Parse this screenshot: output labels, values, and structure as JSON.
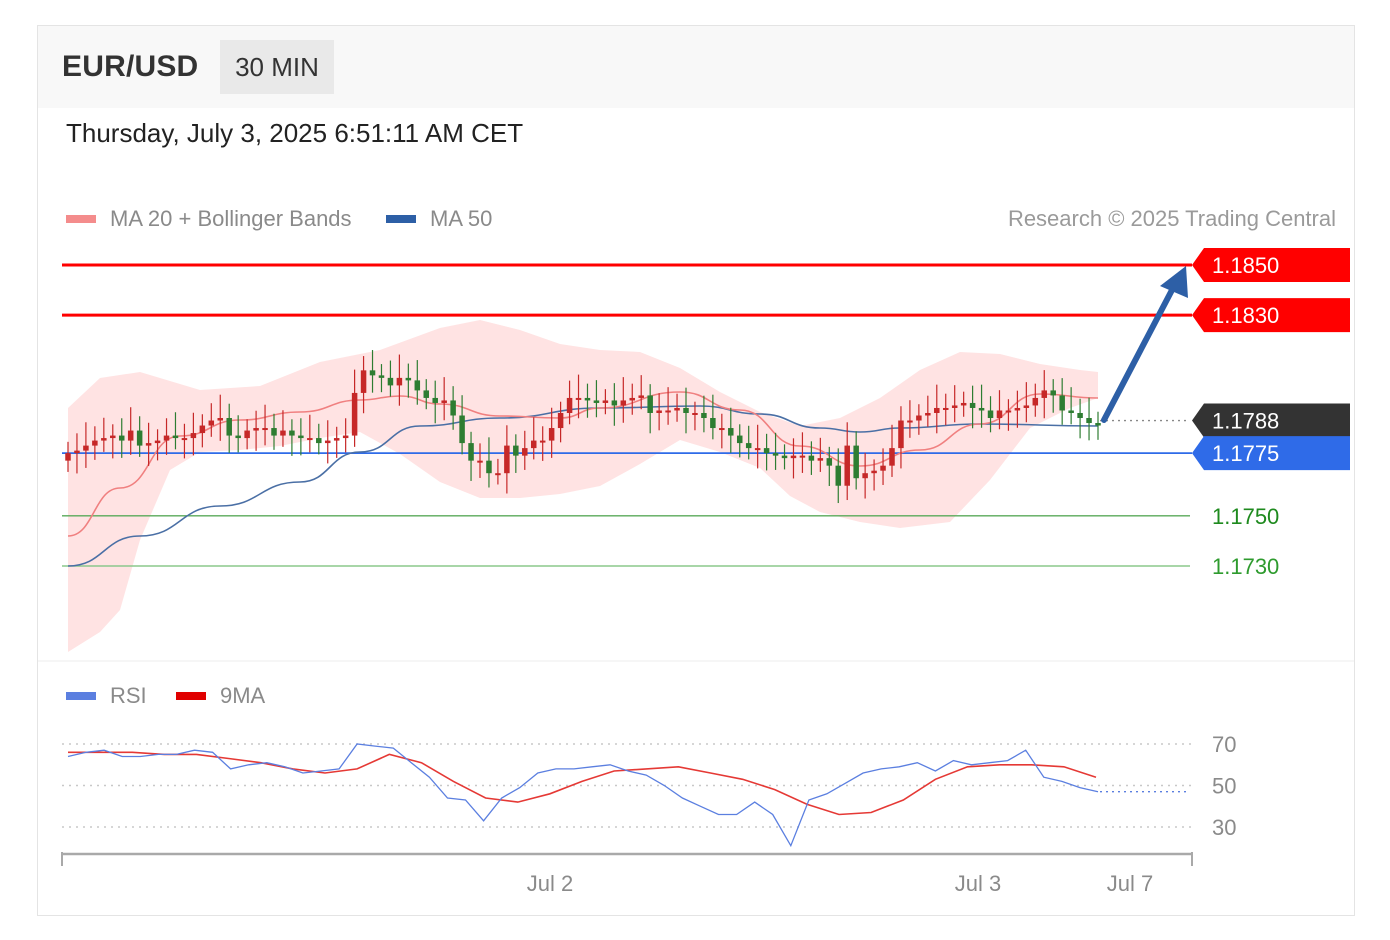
{
  "header": {
    "instrument": "EUR/USD",
    "timeframe": "30 MIN",
    "timestamp": "Thursday, July 3, 2025 6:51:11 AM CET"
  },
  "legend": {
    "ma20_bb": "MA 20 + Bollinger Bands",
    "ma50": "MA 50",
    "rsi": "RSI",
    "rsi_ma": "9MA"
  },
  "credit": "Research © 2025 Trading Central",
  "colors": {
    "resistance": "#ff0000",
    "support": "#2e9b2e",
    "pivot": "#2f6be8",
    "last_price_tag": "#333333",
    "bollinger_fill": "#ffe3e3",
    "ma20": "#f08080",
    "ma50": "#4a6fa5",
    "candle_up": "#c62828",
    "candle_down": "#2e7d32",
    "rsi": "#5b7fe0",
    "rsi_ma": "#e53935",
    "arrow": "#2d5fa6"
  },
  "chart_data": [
    {
      "type": "candlestick",
      "title": "EUR/USD 30 MIN",
      "x_labels": [
        "Jul 2",
        "Jul 3",
        "Jul 7"
      ],
      "ylim": [
        1.7705,
        1.1862
      ],
      "levels": [
        {
          "value": 1.185,
          "label": "1.1850",
          "kind": "resistance"
        },
        {
          "value": 1.183,
          "label": "1.1830",
          "kind": "resistance"
        },
        {
          "value": 1.1788,
          "label": "1.1788",
          "kind": "last"
        },
        {
          "value": 1.1775,
          "label": "1.1775",
          "kind": "pivot"
        },
        {
          "value": 1.175,
          "label": "1.1750",
          "kind": "support"
        },
        {
          "value": 1.173,
          "label": "1.1730",
          "kind": "support"
        }
      ],
      "target_arrow": {
        "from": 1.1788,
        "to": 1.185
      },
      "series": [
        {
          "name": "Close",
          "values": [
            1.1775,
            1.1776,
            1.1778,
            1.178,
            1.1781,
            1.1782,
            1.178,
            1.1784,
            1.1778,
            1.1779,
            1.178,
            1.1782,
            1.1781,
            1.1781,
            1.1783,
            1.1786,
            1.1788,
            1.1789,
            1.1782,
            1.1781,
            1.1784,
            1.1785,
            1.1785,
            1.1782,
            1.1784,
            1.1782,
            1.1781,
            1.1781,
            1.1779,
            1.178,
            1.1781,
            1.1782,
            1.1799,
            1.1808,
            1.1806,
            1.1805,
            1.1802,
            1.1805,
            1.1804,
            1.18,
            1.1797,
            1.1795,
            1.1796,
            1.179,
            1.1779,
            1.1772,
            1.1772,
            1.1767,
            1.1767,
            1.1778,
            1.1774,
            1.1777,
            1.178,
            1.178,
            1.1785,
            1.1791,
            1.1797,
            1.1797,
            1.1796,
            1.1795,
            1.1796,
            1.1794,
            1.1796,
            1.1797,
            1.1798,
            1.1791,
            1.1792,
            1.1792,
            1.1793,
            1.1791,
            1.1791,
            1.1789,
            1.1785,
            1.1785,
            1.1782,
            1.1779,
            1.1777,
            1.1777,
            1.1775,
            1.1774,
            1.1773,
            1.1774,
            1.1774,
            1.1772,
            1.1773,
            1.177,
            1.1762,
            1.1778,
            1.1765,
            1.1767,
            1.1768,
            1.177,
            1.1777,
            1.1788,
            1.1788,
            1.179,
            1.1791,
            1.1793,
            1.1793,
            1.1794,
            1.1795,
            1.1793,
            1.1792,
            1.1789,
            1.1792,
            1.1792,
            1.1793,
            1.1794,
            1.1797,
            1.18,
            1.1798,
            1.1792,
            1.1791,
            1.1789,
            1.1787,
            1.1786
          ]
        },
        {
          "name": "MA 50",
          "values": [
            1.1743,
            1.1772,
            1.1785,
            1.1782,
            1.1781,
            1.1788
          ]
        },
        {
          "name": "MA 20",
          "values": [
            1.1755,
            1.1785,
            1.1794,
            1.1778,
            1.1794,
            1.1795
          ]
        }
      ]
    },
    {
      "type": "line",
      "title": "RSI",
      "ylim": [
        20,
        80
      ],
      "y_ticks": [
        "70",
        "50",
        "30"
      ],
      "series": [
        {
          "name": "RSI",
          "values": [
            64,
            66,
            67,
            64,
            64,
            65,
            65,
            67,
            66,
            58,
            60,
            61,
            59,
            56,
            57,
            58,
            70,
            69,
            68,
            61,
            54,
            44,
            43,
            33,
            44,
            49,
            56,
            58,
            58,
            59,
            60,
            57,
            55,
            50,
            44,
            40,
            36,
            36,
            42,
            36,
            21,
            43,
            46,
            51,
            56,
            58,
            59,
            61,
            57,
            62,
            60,
            61,
            62,
            67,
            54,
            52,
            49,
            47
          ]
        },
        {
          "name": "9MA",
          "values": [
            66,
            66,
            66,
            65,
            65,
            63,
            61,
            58,
            56,
            58,
            65,
            61,
            52,
            44,
            42,
            46,
            52,
            57,
            58,
            59,
            56,
            53,
            48,
            41,
            36,
            37,
            43,
            53,
            59,
            60,
            60,
            59,
            54
          ]
        }
      ]
    }
  ]
}
